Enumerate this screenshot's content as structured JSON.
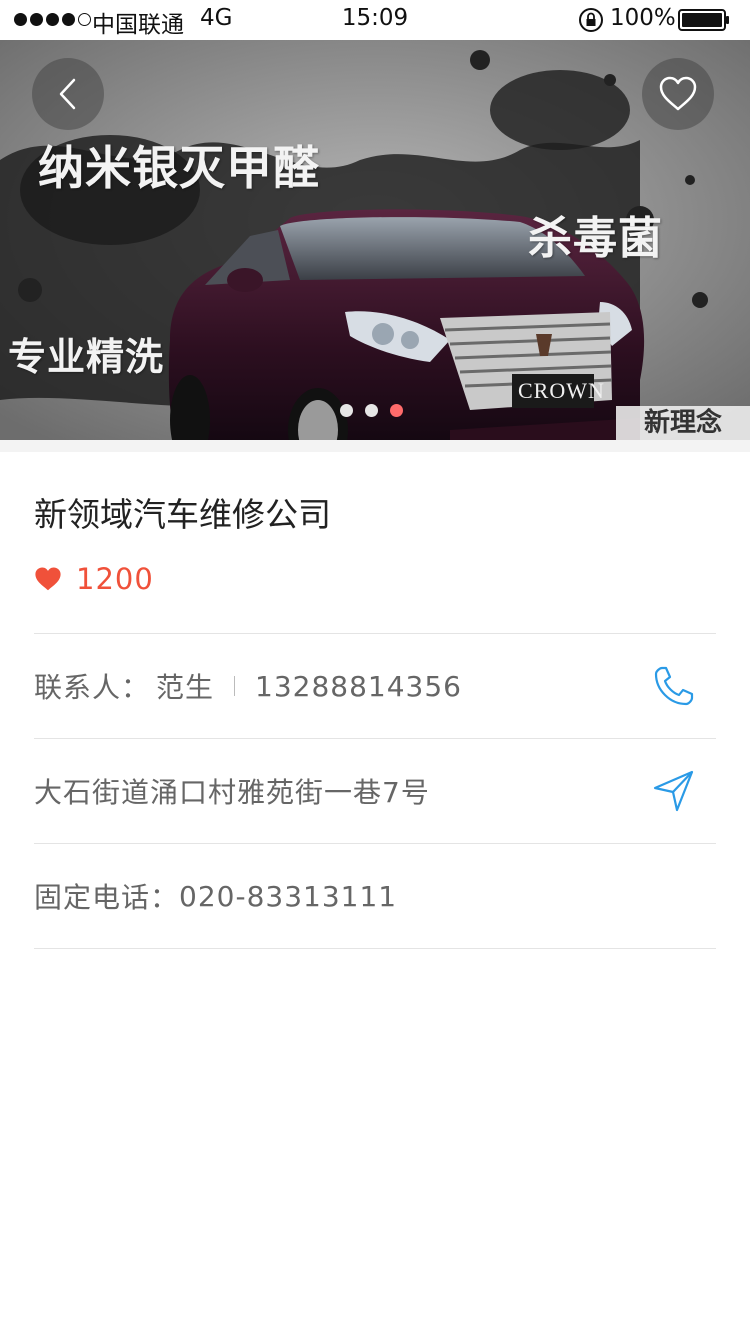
{
  "status_bar": {
    "carrier": "中国联通",
    "network": "4G",
    "time": "15:09",
    "battery": "100%"
  },
  "banner": {
    "slogan_1": "纳米银灭甲醛",
    "slogan_2": "杀毒菌",
    "slogan_3": "专业精洗",
    "corner_tag": "新理念",
    "car_badge": "CROWN",
    "slides_total": 3,
    "active_slide": 3
  },
  "shop": {
    "name": "新领域汽车维修公司",
    "likes": "1200"
  },
  "details": {
    "contact_label": "联系人：",
    "contact_name": "范生",
    "contact_phone": "13288814356",
    "address": "大石街道涌口村雅苑街一巷7号",
    "landline_label": "固定电话：",
    "landline": "020-83313111"
  },
  "colors": {
    "accent_blue": "#2a9ae6",
    "heart_red": "#f0513a",
    "active_dot": "#ff6b6b"
  },
  "icons": {
    "back": "chevron-left-icon",
    "favorite": "heart-outline-icon",
    "likes": "heart-filled-icon",
    "phone": "phone-icon",
    "navigate": "navigation-arrow-icon"
  }
}
